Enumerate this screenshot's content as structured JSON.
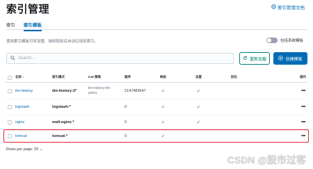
{
  "page": {
    "title": "索引管理",
    "doc_link": "索引管理文档"
  },
  "tabs": [
    {
      "label": "索引",
      "active": false
    },
    {
      "label": "索引模板",
      "active": true
    }
  ],
  "description": "使用索引模板可将设置、映射和别名自动应用到索引。",
  "toggle": {
    "label": "包括系统模板",
    "on": false
  },
  "search": {
    "placeholder": "Search..."
  },
  "buttons": {
    "reload": "重新加载",
    "create": "创建模板"
  },
  "table": {
    "headers": [
      "名称 ↑",
      "索引模式",
      "ILM 策略",
      "顺序",
      "映射",
      "设置",
      "别名",
      "操作"
    ],
    "rows": [
      {
        "name": "ilm-history",
        "pattern": "ilm-history-2*",
        "ilm": "ilm-history-ilm-policy",
        "order": "2147483647",
        "mapping": "✓",
        "settings": "✓",
        "alias": ""
      },
      {
        "name": "logstash",
        "pattern": "logstash-*",
        "ilm": "",
        "order": "0",
        "mapping": "✓",
        "settings": "✓",
        "alias": ""
      },
      {
        "name": "nginx",
        "pattern": "mall-nginx-*",
        "ilm": "",
        "order": "0",
        "mapping": "✓",
        "settings": "✓",
        "alias": ""
      },
      {
        "name": "tomcat",
        "pattern": "tomcat-*",
        "ilm": "",
        "order": "0",
        "mapping": "✓",
        "settings": "",
        "alias": ""
      }
    ]
  },
  "pager": {
    "label": "Rows per page: 20 ⌄"
  },
  "watermark": "CSDN @股市过客",
  "colors": {
    "accent": "#006bb4",
    "secondary": "#017d73",
    "highlight": "#e0232e"
  }
}
